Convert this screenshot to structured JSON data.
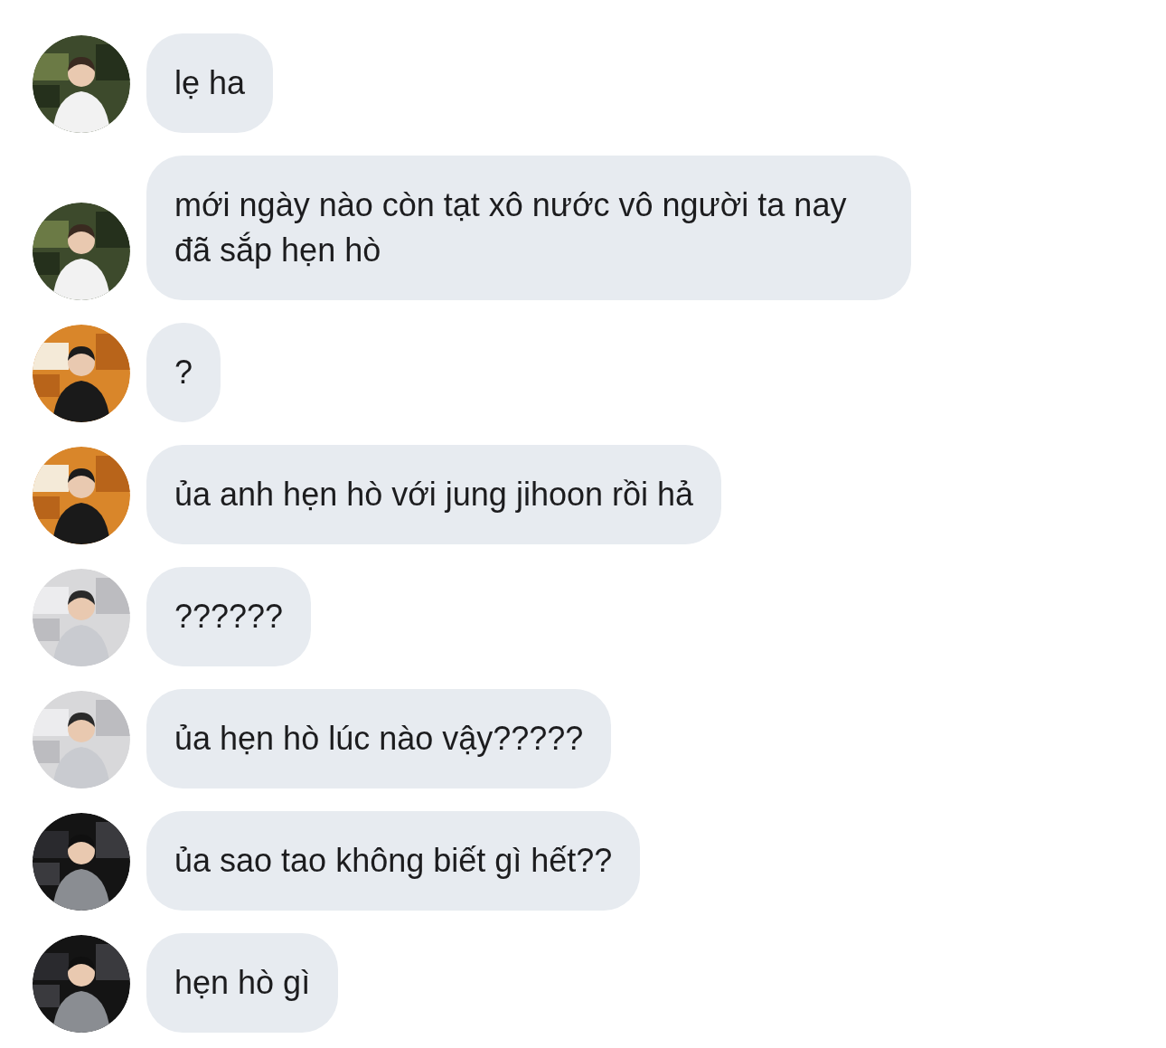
{
  "messages": [
    {
      "text": "lẹ ha"
    },
    {
      "text": "mới ngày nào còn tạt xô nước vô người ta nay đã sắp hẹn hò"
    },
    {
      "text": "?"
    },
    {
      "text": "ủa anh hẹn hò với jung jihoon rồi hả"
    },
    {
      "text": "??????"
    },
    {
      "text": "ủa hẹn hò lúc nào vậy?????"
    },
    {
      "text": "ủa sao tao không biết gì hết??"
    },
    {
      "text": "hẹn hò gì"
    }
  ]
}
